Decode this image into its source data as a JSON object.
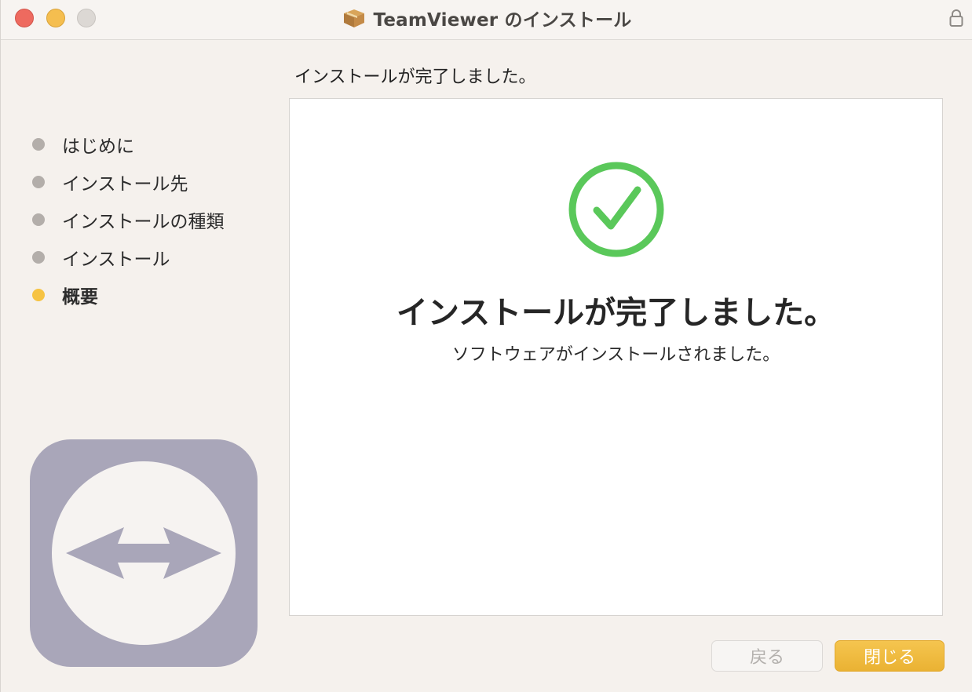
{
  "window": {
    "title": "TeamViewer のインストール",
    "title_icon": "package-icon",
    "lock_icon": "lock-icon"
  },
  "step_header": "インストールが完了しました。",
  "steps": [
    {
      "label": "はじめに",
      "active": false
    },
    {
      "label": "インストール先",
      "active": false
    },
    {
      "label": "インストールの種類",
      "active": false
    },
    {
      "label": "インストール",
      "active": false
    },
    {
      "label": "概要",
      "active": true
    }
  ],
  "main": {
    "status_icon": "checkmark-circle-icon",
    "title": "インストールが完了しました。",
    "subtitle": "ソフトウェアがインストールされました。"
  },
  "buttons": {
    "back_label": "戻る",
    "close_label": "閉じる"
  },
  "colors": {
    "accent": "#f2bb3f",
    "active_dot": "#f6c343",
    "inactive_dot": "#b3aeaa",
    "check_green": "#5ac85a",
    "logo_gray": "#a9a6b9"
  }
}
